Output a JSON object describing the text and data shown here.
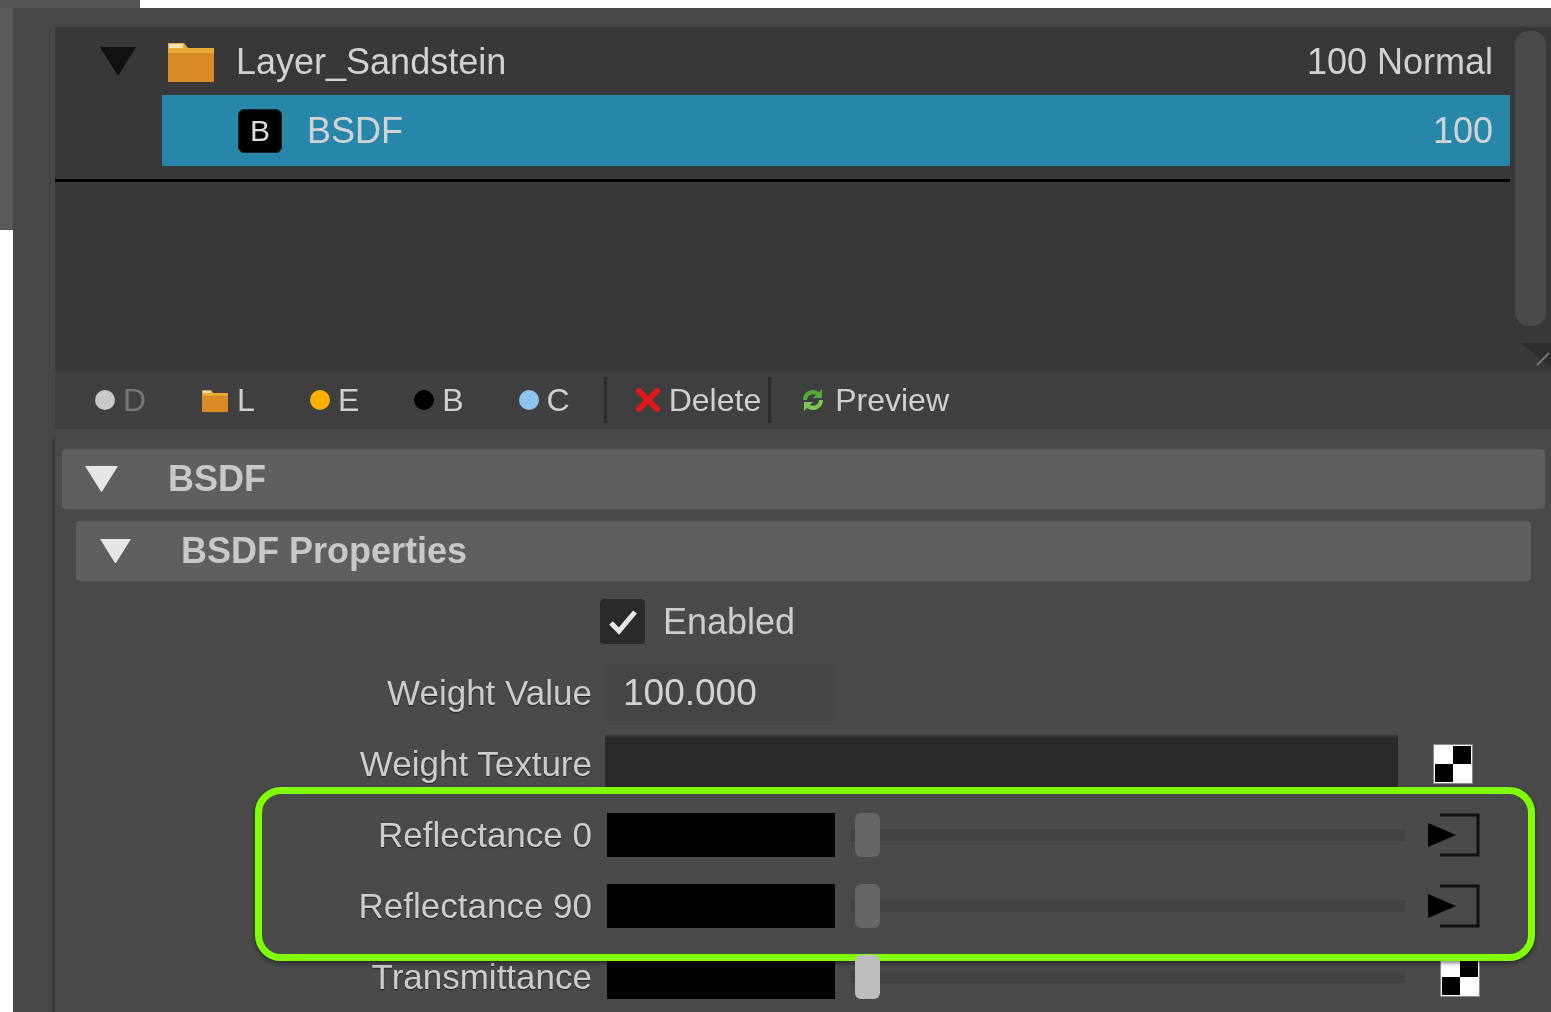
{
  "layers": [
    {
      "name": "Layer_Sandstein",
      "info": "100 Normal",
      "kind": "folder",
      "expanded": true,
      "selected": false,
      "children": [
        {
          "name": "BSDF",
          "info": "100",
          "kind": "bsdf",
          "badge": "B",
          "selected": true
        }
      ]
    }
  ],
  "toolbar": [
    {
      "label": "D",
      "kind": "dot",
      "color": "#c8c8c8",
      "disabled": true
    },
    {
      "label": "L",
      "kind": "folder",
      "disabled": false
    },
    {
      "label": "E",
      "kind": "dot",
      "color": "#ffb000",
      "disabled": false
    },
    {
      "label": "B",
      "kind": "dot",
      "color": "#000000",
      "disabled": false
    },
    {
      "label": "C",
      "kind": "dot",
      "color": "#8ec4f0",
      "disabled": false
    },
    {
      "label": "Delete",
      "kind": "delete",
      "disabled": false
    },
    {
      "label": "Preview",
      "kind": "preview",
      "disabled": false
    }
  ],
  "sections": [
    {
      "title": "BSDF",
      "expanded": true,
      "subsections": [
        {
          "title": "BSDF Properties",
          "expanded": true,
          "properties": [
            {
              "kind": "checkbox",
              "label": "Enabled",
              "checked": true
            },
            {
              "kind": "number",
              "label": "Weight Value",
              "value": "100.000"
            },
            {
              "kind": "texture",
              "label": "Weight Texture"
            },
            {
              "kind": "colorlink",
              "label": "Reflectance 0",
              "color": "#000000",
              "level": 0,
              "highlighted": true
            },
            {
              "kind": "colorlink",
              "label": "Reflectance 90",
              "color": "#000000",
              "level": 0,
              "highlighted": true
            },
            {
              "kind": "colortexture",
              "label": "Transmittance",
              "color": "#000000",
              "level": 0,
              "highlighted": false
            }
          ]
        }
      ]
    }
  ]
}
